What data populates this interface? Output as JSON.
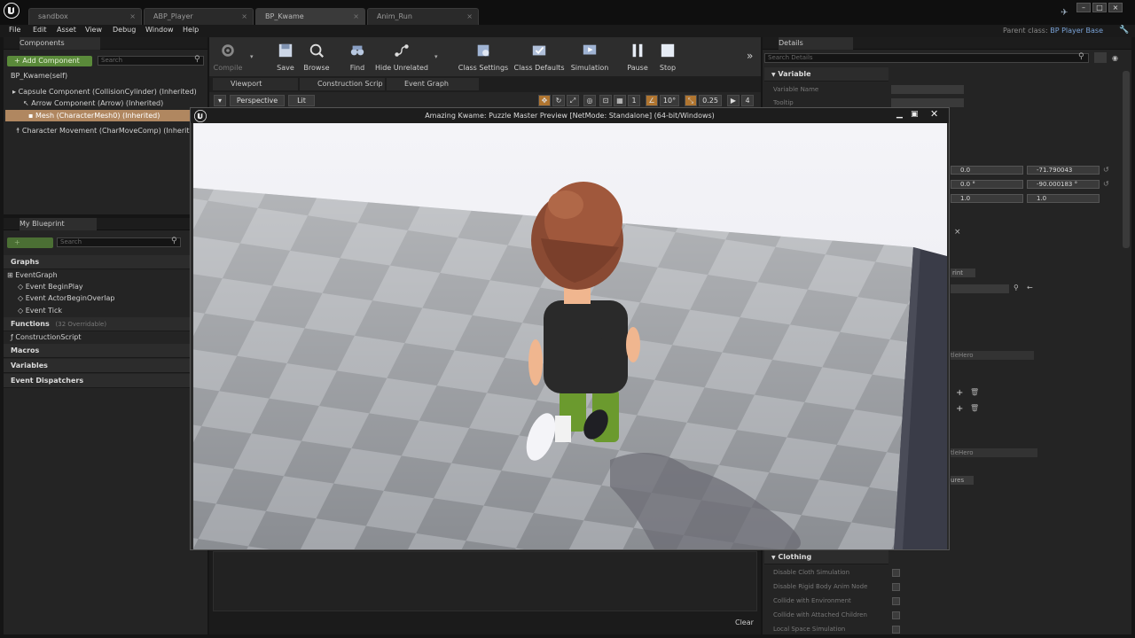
{
  "tabs": [
    {
      "label": "sandbox",
      "active": false
    },
    {
      "label": "ABP_Player",
      "active": false
    },
    {
      "label": "BP_Kwame",
      "active": true
    },
    {
      "label": "Anim_Run",
      "active": false
    }
  ],
  "menu": [
    "File",
    "Edit",
    "Asset",
    "View",
    "Debug",
    "Window",
    "Help"
  ],
  "parent_class": {
    "label": "Parent class:",
    "value": "BP Player Base"
  },
  "components": {
    "title": "Components",
    "add_button": "+ Add Component",
    "search_placeholder": "Search",
    "root": "BP_Kwame(self)",
    "items": [
      {
        "label": "Capsule Component (CollisionCylinder) (Inherited)",
        "selected": false
      },
      {
        "label": "Arrow Component (Arrow) (Inherited)",
        "selected": false
      },
      {
        "label": "Mesh (CharacterMesh0) (Inherited)",
        "selected": true
      },
      {
        "label": "Character Movement (CharMoveComp) (Inherited)",
        "selected": false
      }
    ]
  },
  "my_blueprint": {
    "title": "My Blueprint",
    "search_placeholder": "Search",
    "graphs_label": "Graphs",
    "event_graph": "EventGraph",
    "events": [
      "Event BeginPlay",
      "Event ActorBeginOverlap",
      "Event Tick"
    ],
    "functions_label": "Functions",
    "functions_count": "(32 Overridable)",
    "construction_script": "ConstructionScript",
    "macros": "Macros",
    "variables": "Variables",
    "event_dispatchers": "Event Dispatchers"
  },
  "toolbar": {
    "compile": "Compile",
    "save": "Save",
    "browse": "Browse",
    "find": "Find",
    "hide_unrelated": "Hide Unrelated",
    "class_settings": "Class Settings",
    "class_defaults": "Class Defaults",
    "simulation": "Simulation",
    "pause": "Pause",
    "stop": "Stop"
  },
  "editor_tabs": [
    "Viewport",
    "Construction Scrip",
    "Event Graph"
  ],
  "viewport_toolbar": {
    "perspective": "Perspective",
    "lit": "Lit",
    "snap1": "1",
    "angle": "10°",
    "scale": "0.25",
    "cam": "4"
  },
  "preview_window": {
    "title": "Amazing Kwame: Puzzle Master Preview [NetMode: Standalone]  (64-bit/Windows)"
  },
  "details": {
    "title": "Details",
    "search_placeholder": "Search Details",
    "variable_section": "Variable",
    "variable_name_label": "Variable Name",
    "tooltip_label": "Tooltip",
    "rot_values": [
      "0.0",
      "-71.790043"
    ],
    "rot_values2": [
      "0.0 °",
      "-90.000183 °"
    ],
    "scale_values": [
      "1.0",
      "1.0"
    ],
    "dropdown_partial1": "tleHero",
    "dropdown_partial2": "tleHero",
    "dropdown_partial3": "ures",
    "dropdown_partial4": "rint",
    "clothing_section": "Clothing",
    "clothing_rows": [
      "Disable Cloth Simulation",
      "Disable Rigid Body Anim Node",
      "Collide with Environment",
      "Collide with Attached Children",
      "Local Space Simulation"
    ]
  },
  "bottom": {
    "clear": "Clear"
  }
}
